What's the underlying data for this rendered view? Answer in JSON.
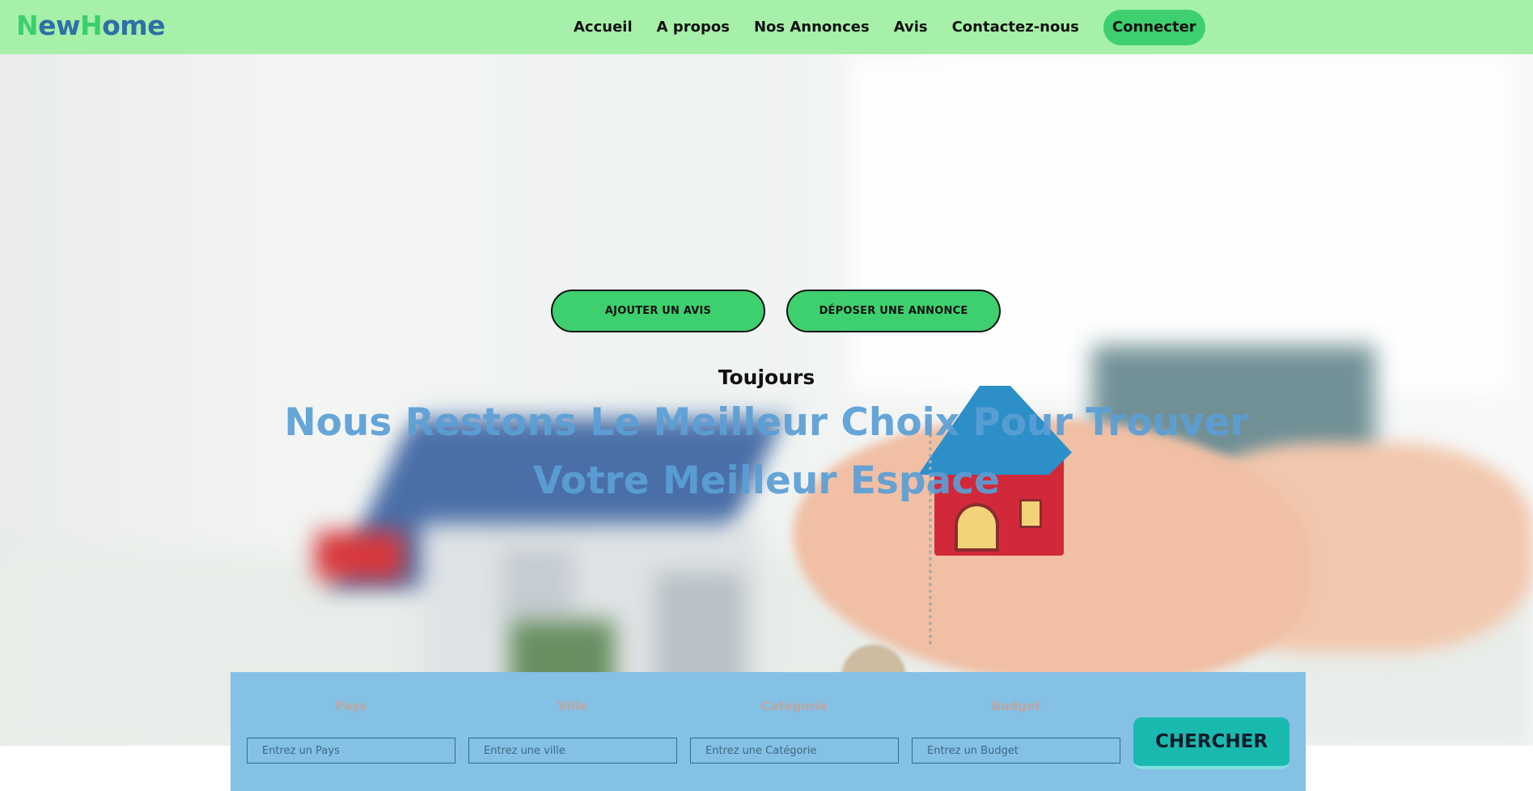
{
  "brand": {
    "part1": "N",
    "part2": "ew",
    "part3": "H",
    "part4": "ome"
  },
  "nav": {
    "links": [
      "Accueil",
      "A propos",
      "Nos Annonces",
      "Avis",
      "Contactez-nous"
    ],
    "connect": "Connecter"
  },
  "hero": {
    "btn_avis": "AJOUTER UN AVIS",
    "btn_annonce": "DÉPOSER UNE ANNONCE",
    "subtitle": "Toujours",
    "title": "Nous Restons Le Meilleur Choix Pour Trouver Votre Meilleur Espace"
  },
  "search": {
    "fields": [
      {
        "label": "Pays",
        "placeholder": "Entrez un Pays"
      },
      {
        "label": "Ville",
        "placeholder": "Entrez une ville"
      },
      {
        "label": "Catégorie",
        "placeholder": "Entrez une Catégorie"
      },
      {
        "label": "Budget",
        "placeholder": "Entrez un Budget"
      }
    ],
    "button": "CHERCHER"
  },
  "colors": {
    "nav_bg": "#a6f0a9",
    "accent_green": "#3ecf6e",
    "brand_blue": "#2f6fa6",
    "title_blue": "#5b9fd6",
    "search_bg": "#85c0e5",
    "search_button": "#19b9b0"
  }
}
